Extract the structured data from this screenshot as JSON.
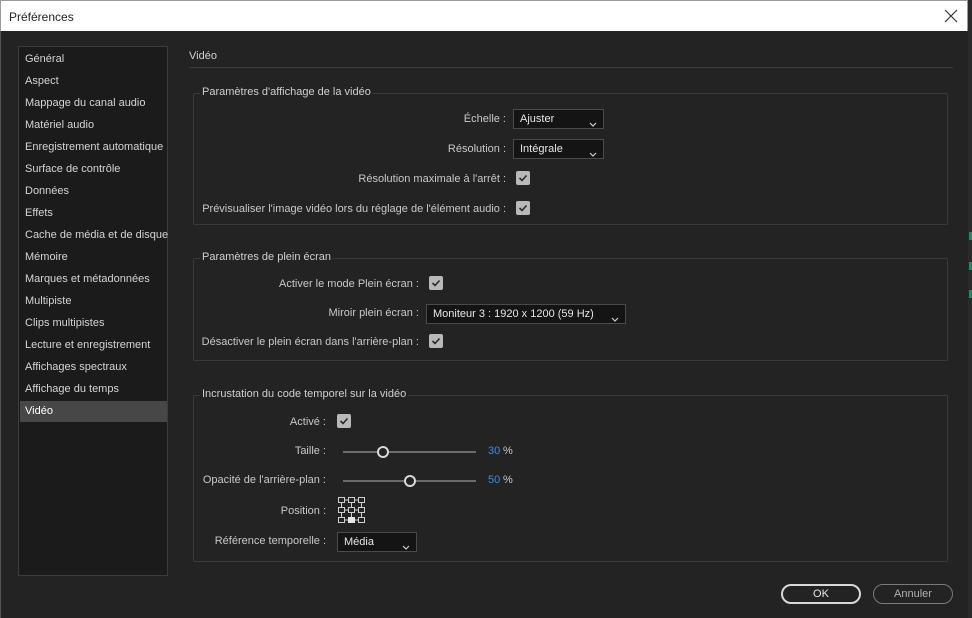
{
  "window": {
    "title": "Préférences"
  },
  "sidebar": {
    "items": [
      {
        "label": "Général"
      },
      {
        "label": "Aspect"
      },
      {
        "label": "Mappage du canal audio"
      },
      {
        "label": "Matériel audio"
      },
      {
        "label": "Enregistrement automatique"
      },
      {
        "label": "Surface de contrôle"
      },
      {
        "label": "Données"
      },
      {
        "label": "Effets"
      },
      {
        "label": "Cache de média et de disque"
      },
      {
        "label": "Mémoire"
      },
      {
        "label": "Marques et métadonnées"
      },
      {
        "label": "Multipiste"
      },
      {
        "label": "Clips multipistes"
      },
      {
        "label": "Lecture et enregistrement"
      },
      {
        "label": "Affichages spectraux"
      },
      {
        "label": "Affichage du temps"
      },
      {
        "label": "Vidéo"
      }
    ],
    "selected": "Vidéo"
  },
  "page": {
    "title": "Vidéo"
  },
  "display_settings": {
    "title": "Paramètres d'affichage de la vidéo",
    "scale": {
      "label": "Échelle :",
      "value": "Ajuster"
    },
    "resolution": {
      "label": "Résolution :",
      "value": "Intégrale"
    },
    "max_res_paused": {
      "label": "Résolution maximale à l'arrêt :",
      "checked": true
    },
    "preview_audio": {
      "label": "Prévisualiser l'image vidéo lors du réglage de l'élément audio :",
      "checked": true
    }
  },
  "fullscreen": {
    "title": "Paramètres de plein écran",
    "enable": {
      "label": "Activer le mode Plein écran :",
      "checked": true
    },
    "mirror": {
      "label": "Miroir plein écran :",
      "value": "Moniteur 3 : 1920 x 1200 (59 Hz)"
    },
    "disable_background": {
      "label": "Désactiver le plein écran dans l'arrière-plan :",
      "checked": true
    }
  },
  "timecode_overlay": {
    "title": "Incrustation du code temporel sur la vidéo",
    "active": {
      "label": "Activé :",
      "checked": true
    },
    "size": {
      "label": "Taille :",
      "value": "30",
      "unit": "%",
      "level": 0.3
    },
    "bg_opacity": {
      "label": "Opacité de l'arrière-plan :",
      "value": "50",
      "unit": "%",
      "level": 0.5
    },
    "position": {
      "label": "Position :",
      "selected_cell": "bottom-center"
    },
    "time_reference": {
      "label": "Référence temporelle :",
      "value": "Média"
    }
  },
  "buttons": {
    "ok": "OK",
    "cancel": "Annuler"
  },
  "colors": {
    "accent_value": "#3a8ee6",
    "selected_item": "#474747",
    "background": "#232323"
  },
  "icons": {
    "close": "close-icon",
    "chevron": "chevron-down-icon",
    "check": "check-icon"
  }
}
